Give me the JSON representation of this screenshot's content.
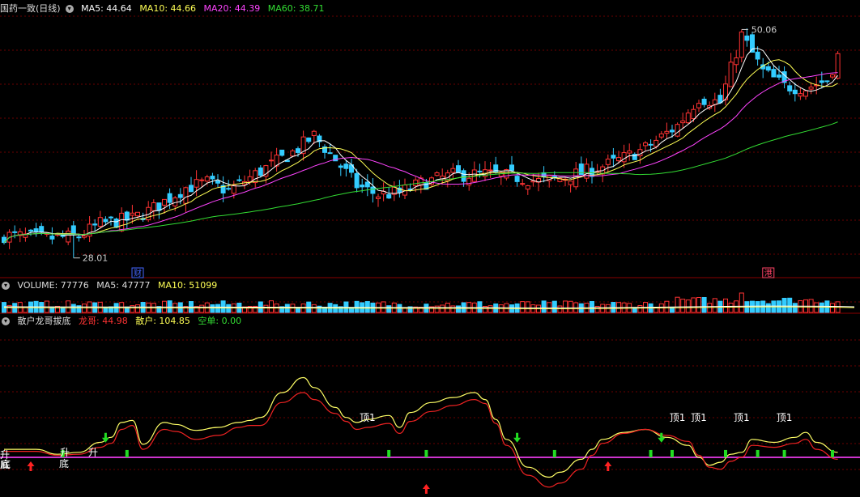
{
  "price_panel": {
    "title": "国药一致(日线)",
    "ma_labels": [
      {
        "text": "MA5: 44.64",
        "color": "#ffffff"
      },
      {
        "text": "MA10: 44.66",
        "color": "#ffff55"
      },
      {
        "text": "MA20: 44.39",
        "color": "#ff44ff"
      },
      {
        "text": "MA60: 38.71",
        "color": "#33dd33"
      }
    ],
    "high_label": "50.06",
    "low_label": "28.01",
    "tags": [
      "财",
      "港"
    ]
  },
  "volume_panel": {
    "labels": [
      {
        "text": "VOLUME: 77776",
        "color": "#dddddd"
      },
      {
        "text": "MA5: 47777",
        "color": "#dddddd"
      },
      {
        "text": "MA10: 51099",
        "color": "#ffff55"
      }
    ]
  },
  "indicator_panel": {
    "title": "散户龙哥拔底",
    "labels": [
      {
        "text": "龙哥: 44.98",
        "color": "#ff3333"
      },
      {
        "text": "散户: 104.85",
        "color": "#ffff55"
      },
      {
        "text": "空单: 0.00",
        "color": "#33dd33"
      }
    ],
    "signal_texts": {
      "bottom": "底",
      "rise": "升",
      "top": "顶1"
    }
  },
  "colors": {
    "up": "#ff3333",
    "down": "#33ccff",
    "ma5": "#ffffff",
    "ma10": "#ffff55",
    "ma20": "#ff44ff",
    "ma60": "#33dd33",
    "grid": "#6a0000",
    "baseline": "#cc33cc",
    "longge": "#ee2222",
    "sanhu": "#ffff66"
  },
  "chart_data": [
    {
      "type": "candlestick",
      "title": "国药一致(日线)",
      "price_range": [
        26.5,
        51.5
      ],
      "trend_points": [
        [
          0,
          30.2
        ],
        [
          8,
          29.9
        ],
        [
          14,
          30.1
        ],
        [
          18,
          31.3
        ],
        [
          24,
          31.8
        ],
        [
          28,
          32.8
        ],
        [
          34,
          34.8
        ],
        [
          38,
          35.3
        ],
        [
          42,
          34.5
        ],
        [
          48,
          36.4
        ],
        [
          54,
          38.2
        ],
        [
          58,
          39.8
        ],
        [
          62,
          37.5
        ],
        [
          66,
          35.0
        ],
        [
          70,
          34.1
        ],
        [
          74,
          34.3
        ],
        [
          78,
          35.2
        ],
        [
          84,
          36.0
        ],
        [
          90,
          36.1
        ],
        [
          96,
          35.8
        ],
        [
          100,
          35.4
        ],
        [
          104,
          35.7
        ],
        [
          108,
          36.2
        ],
        [
          114,
          37.2
        ],
        [
          120,
          38.6
        ],
        [
          126,
          40.8
        ],
        [
          130,
          43.5
        ],
        [
          134,
          43.0
        ],
        [
          138,
          49.5
        ],
        [
          142,
          46.0
        ],
        [
          146,
          44.6
        ],
        [
          150,
          44.4
        ],
        [
          154,
          45.2
        ],
        [
          156,
          47.5
        ]
      ],
      "high": 50.06,
      "low": 28.01,
      "ma_last": {
        "MA5": 44.64,
        "MA10": 44.66,
        "MA20": 44.39,
        "MA60": 38.71
      }
    },
    {
      "type": "bar",
      "title": "VOLUME",
      "last": {
        "VOLUME": 77776,
        "MA5": 47777,
        "MA10": 51099
      }
    },
    {
      "type": "line",
      "title": "散户龙哥拔底",
      "y_range": [
        -35,
        130
      ],
      "series": [
        {
          "name": "散户",
          "x": [
            0,
            6,
            10,
            14,
            18,
            20,
            22,
            24,
            26,
            30,
            32,
            36,
            40,
            44,
            46,
            48,
            52,
            56,
            58,
            62,
            64,
            66,
            68,
            72,
            74,
            76,
            80,
            84,
            88,
            90,
            92,
            94,
            98,
            102,
            104,
            108,
            110,
            112,
            116,
            120,
            124,
            128,
            130,
            132,
            134,
            136,
            138,
            140,
            144,
            148,
            150,
            152,
            156
          ],
          "values": [
            8,
            8,
            3,
            5,
            15,
            20,
            35,
            37,
            13,
            35,
            33,
            27,
            30,
            35,
            37,
            40,
            65,
            80,
            70,
            50,
            40,
            35,
            38,
            42,
            30,
            45,
            55,
            60,
            65,
            58,
            38,
            18,
            -10,
            -20,
            -15,
            -2,
            8,
            18,
            25,
            28,
            20,
            12,
            0,
            -8,
            -5,
            3,
            5,
            18,
            15,
            20,
            25,
            15,
            5
          ]
        },
        {
          "name": "龙哥",
          "x": [
            0,
            6,
            10,
            14,
            18,
            20,
            22,
            24,
            26,
            30,
            32,
            36,
            40,
            44,
            46,
            48,
            52,
            56,
            58,
            62,
            64,
            66,
            68,
            72,
            74,
            76,
            80,
            84,
            88,
            90,
            92,
            94,
            98,
            102,
            104,
            108,
            110,
            112,
            116,
            120,
            124,
            128,
            130,
            132,
            134,
            136,
            138,
            140,
            144,
            148,
            150,
            152,
            156
          ],
          "values": [
            6,
            6,
            2,
            3,
            10,
            14,
            28,
            32,
            8,
            28,
            26,
            18,
            22,
            30,
            32,
            32,
            55,
            65,
            58,
            44,
            36,
            28,
            30,
            34,
            24,
            36,
            46,
            52,
            58,
            54,
            34,
            12,
            -18,
            -30,
            -26,
            -12,
            2,
            14,
            24,
            28,
            22,
            16,
            2,
            -10,
            -12,
            -4,
            0,
            12,
            10,
            14,
            18,
            8,
            -2
          ]
        },
        {
          "name": "空单",
          "x": [
            0,
            156
          ],
          "values": [
            0,
            0
          ]
        }
      ],
      "last": {
        "龙哥": 44.98,
        "散户": 104.85,
        "空单": 0.0
      }
    }
  ]
}
